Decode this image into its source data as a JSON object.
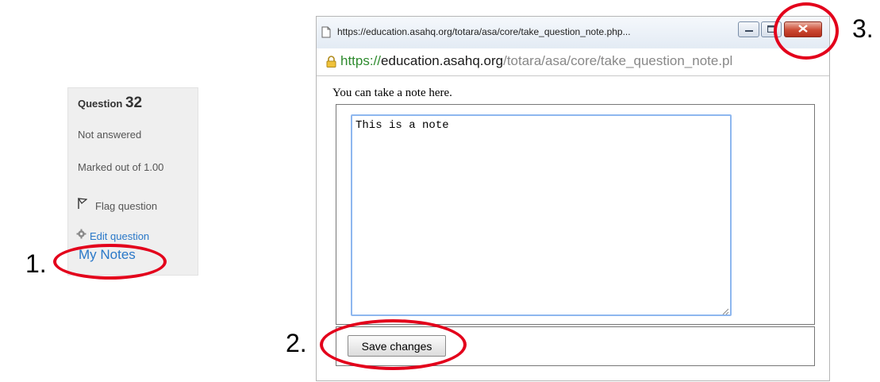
{
  "question_panel": {
    "label": "Question",
    "number": "32",
    "status": "Not answered",
    "marks": "Marked out of 1.00",
    "flag_label": "Flag question",
    "edit_label": "Edit question",
    "notes_link": "My Notes"
  },
  "popup": {
    "window_title": "https://education.asahq.org/totara/asa/core/take_question_note.php...",
    "url_scheme": "https://",
    "url_host": "education.asahq.org",
    "url_path": "/totara/asa/core/take_question_note.pl",
    "instruction": "You can take a note here.",
    "note_text": "This is a note",
    "save_label": "Save changes"
  },
  "annotations": {
    "step1": "1.",
    "step2": "2.",
    "step3": "3."
  },
  "colors": {
    "annotation_red": "#e3001b",
    "link_blue": "#2a78c8",
    "secure_green": "#2e8b2e",
    "textarea_focus": "#8eb7ef"
  },
  "icons": {
    "flag": "flag-icon",
    "gear": "gear-icon",
    "page": "page-icon",
    "lock": "lock-icon",
    "minimize": "minimize-icon",
    "maximize": "maximize-icon",
    "close": "close-icon",
    "resize": "resize-grip-icon"
  }
}
